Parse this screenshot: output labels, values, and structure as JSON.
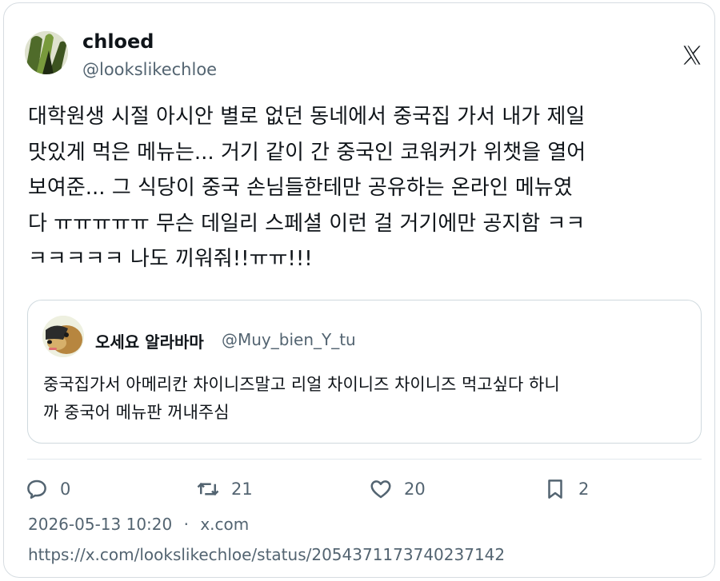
{
  "author": {
    "name": "chloed",
    "handle": "@lookslikechloe"
  },
  "platform_icon": "x-logo-icon",
  "tweet": {
    "text": "대학원생 시절 아시안 별로 없던 동네에서 중국집 가서 내가 제일\n맛있게 먹은 메뉴는... 거기 같이 간 중국인 코워커가 위챗을 열어\n보여준... 그 식당이 중국 손님들한테만 공유하는 온라인 메뉴였\n다 ㅠㅠㅠㅠㅠ 무슨 데일리 스페셜 이런 걸 거기에만 공지함 ㅋㅋ\nㅋㅋㅋㅋㅋ 나도 끼워줘!!ㅠㅠ!!!"
  },
  "quoted": {
    "name": "오세요 알라바마",
    "handle": "@Muy_bien_Y_tu",
    "text": "중국집가서 아메리칸 차이니즈말고 리얼 차이니즈 차이니즈 먹고싶다 하니\n까 중국어 메뉴판 꺼내주심"
  },
  "actions": {
    "replies": "0",
    "retweets": "21",
    "likes": "20",
    "bookmarks": "2"
  },
  "meta": {
    "timestamp": "2026-05-13 10:20",
    "separator": "·",
    "source": "x.com"
  },
  "url": "https://x.com/lookslikechloe/status/2054371173740237142",
  "colors": {
    "text": "#0f1419",
    "secondary": "#536471",
    "border": "#d6dce1"
  }
}
